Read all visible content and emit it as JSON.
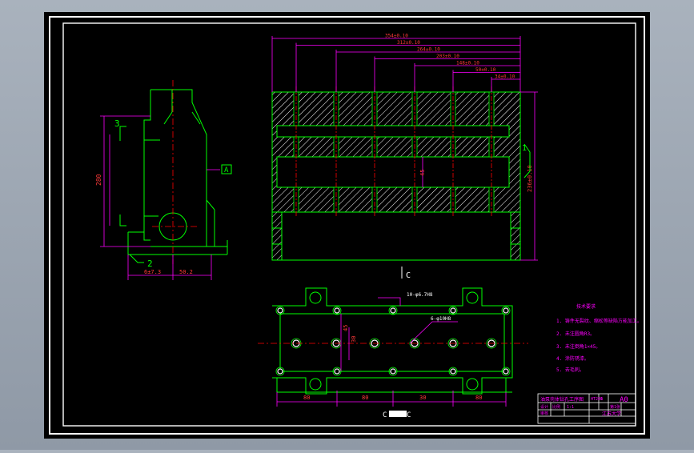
{
  "colors": {
    "background": "#000000",
    "frame": "#ffffff",
    "part": "#00ff00",
    "dims": "#ff00ff",
    "text": "#ff3a3a",
    "center": "#ff0000",
    "hatch": "#ffffff"
  },
  "side_view": {
    "labels": {
      "section_top": "3",
      "section_bottom": "2",
      "datum": "A"
    },
    "dims": {
      "height": "280",
      "width_left": "6±7.3",
      "width_right": "50.2"
    }
  },
  "main_view": {
    "dims_horizontal": [
      "354±0.10",
      "312±0.10",
      "264±0.10",
      "203±0.10",
      "148±0.10",
      "50±0.10",
      "34±0.10"
    ],
    "dim_height": "236±0.10",
    "dim_inner": "45",
    "section_label": "1",
    "view_label": "C"
  },
  "plan_view": {
    "dims_bottom": [
      "80",
      "80",
      "30",
      "80"
    ],
    "dim_left": "45",
    "dim_hole": "30",
    "callout_1": "10-φ6.7H8",
    "callout_2": "6-φ10H8",
    "section_label": "C",
    "section_label_2": "C"
  },
  "tech_notes": {
    "title": "技术要求",
    "items": [
      "1. 铸件无裂纹、缩松等缺陷方能加工。",
      "2. 未注圆角R3。",
      "3. 未注倒角1×45。",
      "4. 涂防锈漆。",
      "5. 去毛刺。"
    ]
  },
  "title_block": {
    "part_name": "油泵壳体钻孔工序图",
    "size": "A0",
    "school": "江苏大学",
    "drawn_label": "设计",
    "checked_label": "审核",
    "scale_label": "比例",
    "scale": "1:1",
    "sheet": "第1张",
    "material": "HT200",
    "quantity": "1"
  }
}
